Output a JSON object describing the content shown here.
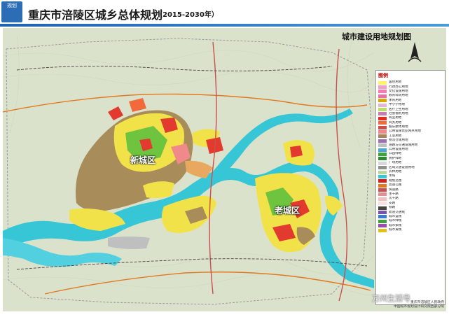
{
  "header": {
    "logo_text": "规划",
    "title": "重庆市涪陵区城乡总体规划",
    "subtitle": "（2015-2030年）"
  },
  "map": {
    "map_title": "城市建设用地规划图",
    "labels": {
      "new_district": "新城区",
      "old_district": "老城区"
    },
    "colors": {
      "river": "#37c6d6",
      "residential": "#f2e24a",
      "commercial": "#e23a2e",
      "industrial": "#a88c5a",
      "greenland": "#6ec43e",
      "hills": "#d8dfc8"
    }
  },
  "legend": {
    "heading": "图例",
    "items": [
      {
        "label": "居住用地",
        "color": "#fff36b"
      },
      {
        "label": "行政办公用地",
        "color": "#f0a0c8"
      },
      {
        "label": "文化设施用地",
        "color": "#f47bb0"
      },
      {
        "label": "教育科研用地",
        "color": "#e86fa8"
      },
      {
        "label": "体育用地",
        "color": "#d6a800"
      },
      {
        "label": "中小学用地",
        "color": "#e3b6d4"
      },
      {
        "label": "医疗卫生用地",
        "color": "#b9e06a"
      },
      {
        "label": "社会福利用地",
        "color": "#c97bb4"
      },
      {
        "label": "商业用地",
        "color": "#e82a1f"
      },
      {
        "label": "商务用地",
        "color": "#f26a3c"
      },
      {
        "label": "娱乐康体用地",
        "color": "#d04a4a"
      },
      {
        "label": "公用设施营业网点用地",
        "color": "#f08a8a"
      },
      {
        "label": "工业用地",
        "color": "#a8845a"
      },
      {
        "label": "物流仓储用地",
        "color": "#9d6fb5"
      },
      {
        "label": "道路与交通设施用地",
        "color": "#bfbfbf"
      },
      {
        "label": "公用设施用地",
        "color": "#4aa6d6"
      },
      {
        "label": "公园绿地",
        "color": "#3ea33a"
      },
      {
        "label": "防护绿地",
        "color": "#2e8a2e"
      },
      {
        "label": "广场用地",
        "color": "#d8d8d8"
      },
      {
        "label": "区域交通设施用地",
        "color": "#8f8f8f"
      },
      {
        "label": "农林用地",
        "color": "#b7d89a"
      },
      {
        "label": "水域",
        "color": "#37c6d6"
      },
      {
        "label": "规划范围",
        "color": "#d32020"
      },
      {
        "label": "高速公路",
        "color": "#e07a20"
      },
      {
        "label": "快速路",
        "color": "#c85050"
      },
      {
        "label": "主干路",
        "color": "#e09090"
      },
      {
        "label": "次干路",
        "color": "#f0c0c0"
      },
      {
        "label": "支路",
        "color": "#f8e0e0"
      },
      {
        "label": "铁路",
        "color": "#444444"
      },
      {
        "label": "轨道交通线",
        "color": "#7a52a8"
      },
      {
        "label": "城市蓝线",
        "color": "#3a7ad0"
      },
      {
        "label": "城市绿线",
        "color": "#40a040"
      },
      {
        "label": "城市紫线",
        "color": "#9a4ab0"
      },
      {
        "label": "城市黄线",
        "color": "#e0c020"
      }
    ]
  },
  "footer": {
    "watermark": "万州生活号",
    "credit_line1": "重庆市涪陵区人民政府",
    "credit_line2": "中国城市规划设计研究院西部分院"
  }
}
